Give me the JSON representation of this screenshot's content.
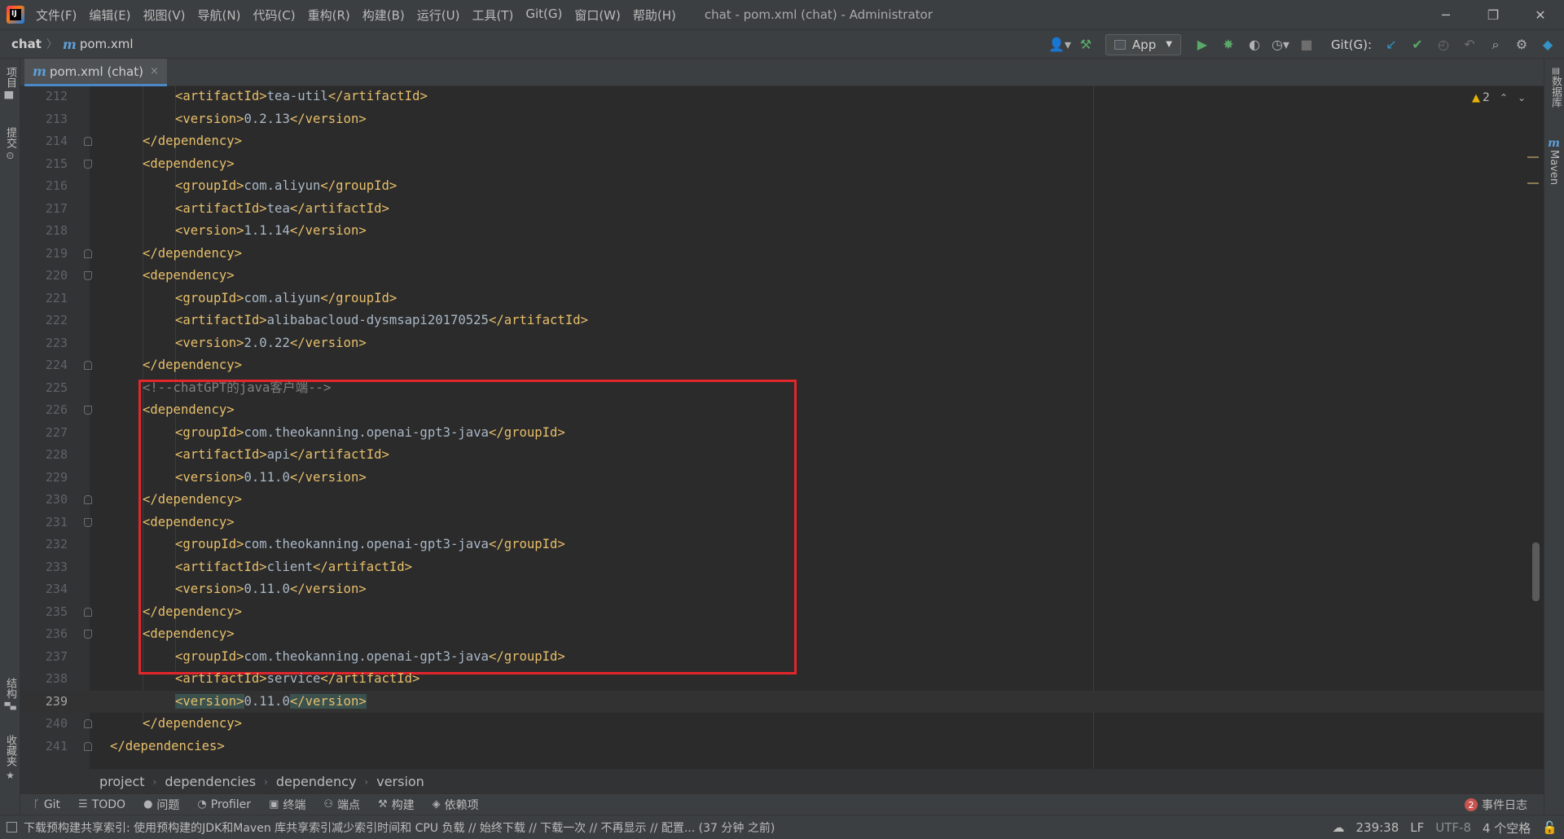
{
  "titlebar": {
    "menu": [
      "文件(F)",
      "编辑(E)",
      "视图(V)",
      "导航(N)",
      "代码(C)",
      "重构(R)",
      "构建(B)",
      "运行(U)",
      "工具(T)",
      "Git(G)",
      "窗口(W)",
      "帮助(H)"
    ],
    "window_title": "chat - pom.xml (chat) - Administrator"
  },
  "navbar": {
    "project": "chat",
    "file_icon_glyph": "m",
    "file": "pom.xml",
    "run_config": "App",
    "git_label": "Git(G):"
  },
  "left_strip": {
    "project_tab": "项目",
    "commit_tab": "提交",
    "structure_tab": "结构",
    "favorites_tab": "收藏夹"
  },
  "right_strip": {
    "database_tab": "数据库",
    "maven_tab": "Maven",
    "maven_icon_glyph": "m"
  },
  "editor_tab": {
    "icon_glyph": "m",
    "label": "pom.xml (chat)",
    "close": "×"
  },
  "inspections": {
    "warning_count": "2"
  },
  "code_lines": [
    {
      "num": "212",
      "indent": 2,
      "tag": "artifactId",
      "text": "tea-util"
    },
    {
      "num": "213",
      "indent": 2,
      "tag": "version",
      "text": "0.2.13"
    },
    {
      "num": "214",
      "indent": 1,
      "close": "dependency",
      "fold": "close"
    },
    {
      "num": "215",
      "indent": 1,
      "open": "dependency",
      "fold": "open"
    },
    {
      "num": "216",
      "indent": 2,
      "tag": "groupId",
      "text": "com.aliyun"
    },
    {
      "num": "217",
      "indent": 2,
      "tag": "artifactId",
      "text": "tea"
    },
    {
      "num": "218",
      "indent": 2,
      "tag": "version",
      "text": "1.1.14"
    },
    {
      "num": "219",
      "indent": 1,
      "close": "dependency",
      "fold": "close"
    },
    {
      "num": "220",
      "indent": 1,
      "open": "dependency",
      "fold": "open"
    },
    {
      "num": "221",
      "indent": 2,
      "tag": "groupId",
      "text": "com.aliyun"
    },
    {
      "num": "222",
      "indent": 2,
      "tag": "artifactId",
      "text": "alibabacloud-dysmsapi20170525"
    },
    {
      "num": "223",
      "indent": 2,
      "tag": "version",
      "text": "2.0.22"
    },
    {
      "num": "224",
      "indent": 1,
      "close": "dependency",
      "fold": "close"
    },
    {
      "num": "225",
      "indent": 1,
      "comment": "<!--chatGPT的java客户端-->"
    },
    {
      "num": "226",
      "indent": 1,
      "open": "dependency",
      "fold": "open"
    },
    {
      "num": "227",
      "indent": 2,
      "tag": "groupId",
      "text": "com.theokanning.openai-gpt3-java"
    },
    {
      "num": "228",
      "indent": 2,
      "tag": "artifactId",
      "text": "api"
    },
    {
      "num": "229",
      "indent": 2,
      "tag": "version",
      "text": "0.11.0"
    },
    {
      "num": "230",
      "indent": 1,
      "close": "dependency",
      "fold": "close"
    },
    {
      "num": "231",
      "indent": 1,
      "open": "dependency",
      "fold": "open"
    },
    {
      "num": "232",
      "indent": 2,
      "tag": "groupId",
      "text": "com.theokanning.openai-gpt3-java"
    },
    {
      "num": "233",
      "indent": 2,
      "tag": "artifactId",
      "text": "client"
    },
    {
      "num": "234",
      "indent": 2,
      "tag": "version",
      "text": "0.11.0"
    },
    {
      "num": "235",
      "indent": 1,
      "close": "dependency",
      "fold": "close"
    },
    {
      "num": "236",
      "indent": 1,
      "open": "dependency",
      "fold": "open"
    },
    {
      "num": "237",
      "indent": 2,
      "tag": "groupId",
      "text": "com.theokanning.openai-gpt3-java"
    },
    {
      "num": "238",
      "indent": 2,
      "tag": "artifactId",
      "text": "service"
    },
    {
      "num": "239",
      "indent": 2,
      "tag": "version",
      "text": "0.11.0",
      "current": true
    },
    {
      "num": "240",
      "indent": 1,
      "close": "dependency",
      "fold": "close"
    },
    {
      "num": "241",
      "indent": 0,
      "close": "dependencies",
      "fold": "close"
    }
  ],
  "breadcrumbs": [
    "project",
    "dependencies",
    "dependency",
    "version"
  ],
  "tool_windows": [
    {
      "icon": "git-icon",
      "glyph": "ᚴ",
      "label": "Git"
    },
    {
      "icon": "todo-icon",
      "glyph": "☰",
      "label": "TODO"
    },
    {
      "icon": "problems-icon",
      "glyph": "●",
      "label": "问题"
    },
    {
      "icon": "profiler-icon",
      "glyph": "◔",
      "label": "Profiler"
    },
    {
      "icon": "terminal-icon",
      "glyph": "▣",
      "label": "终端"
    },
    {
      "icon": "endpoints-icon",
      "glyph": "⚇",
      "label": "端点"
    },
    {
      "icon": "build-icon",
      "glyph": "⚒",
      "label": "构建"
    },
    {
      "icon": "dependencies-icon",
      "glyph": "◈",
      "label": "依赖项"
    }
  ],
  "event_log": {
    "count": "2",
    "label": "事件日志"
  },
  "statusbar": {
    "message": "下载预构建共享索引: 使用预构建的JDK和Maven 库共享索引减少索引时间和 CPU 负载 // 始终下载 // 下载一次 // 不再显示 // 配置... (37 分钟 之前)",
    "position": "239:38",
    "line_sep": "LF",
    "encoding": "UTF-8",
    "indent": "4 个空格"
  },
  "colors": {
    "tag": "#e8bf6a",
    "text": "#a9b7c6",
    "comment": "#808080",
    "highlight_box": "#e3262c",
    "accent": "#4a88c7"
  }
}
